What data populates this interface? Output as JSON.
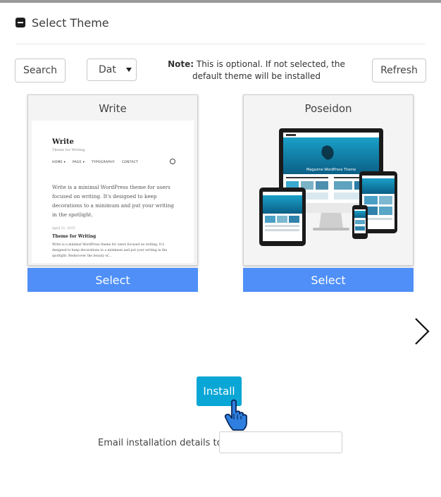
{
  "section": {
    "title": "Select Theme"
  },
  "toolbar": {
    "search_label": "Search",
    "sort_value": "Dat",
    "note_bold": "Note:",
    "note_text": "This is optional. If not selected, the default theme will be installed",
    "refresh_label": "Refresh"
  },
  "themes": [
    {
      "name": "Write",
      "select_label": "Select",
      "preview": {
        "site_title": "Write",
        "tagline": "Theme for Writing",
        "nav": [
          "HOME ▾",
          "PAGE ▾",
          "TYPOGRAPHY",
          "CONTACT"
        ],
        "intro": "Write is a minimal WordPress theme for users focused on writing. It's designed to keep decorations to a minimum and put your writing in the spotlight.",
        "post_date": "April 21, 2015",
        "post_title": "Theme for Writing",
        "post_excerpt": "Write is a minimal WordPress theme for users focused on writing. It's designed to keep decorations to a minimum and put your writing in the spotlight. Rediscover the beauty of..."
      }
    },
    {
      "name": "Poseidon",
      "select_label": "Select",
      "preview": {
        "screen_caption": "Magazine WordPress Theme"
      }
    }
  ],
  "carousel": {
    "next_icon": "chevron-right-icon"
  },
  "install": {
    "label": "Install"
  },
  "email": {
    "label": "Email installation details to :",
    "value": ""
  },
  "colors": {
    "select_button": "#4f8ff7",
    "install_button": "#09a6d6"
  }
}
